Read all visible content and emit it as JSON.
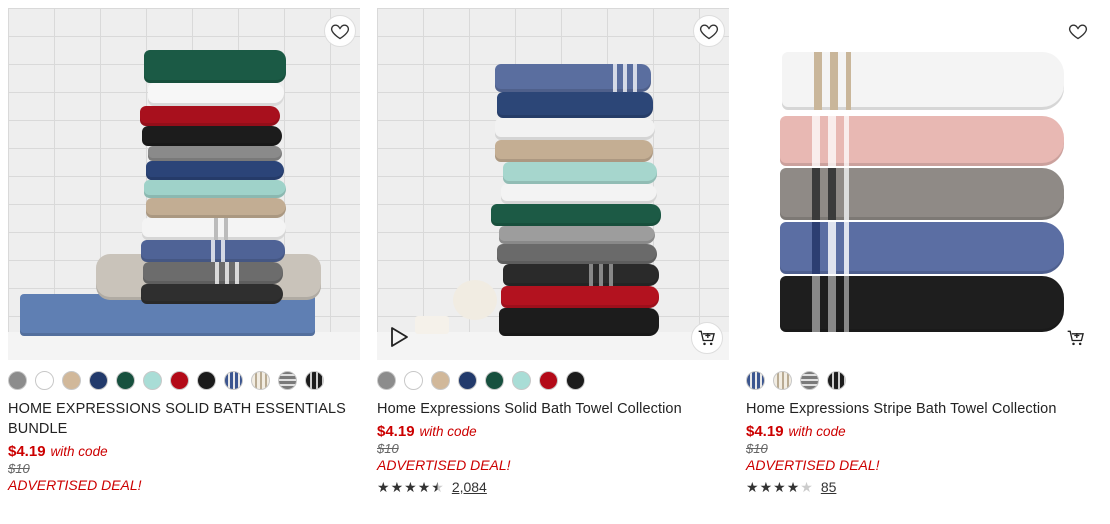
{
  "products": [
    {
      "title": "HOME EXPRESSIONS SOLID BATH ESSENTIALS BUNDLE",
      "price": "$4.19",
      "price_note": "with code",
      "original_price": "$10",
      "deal": "ADVERTISED DEAL!",
      "swatch_colors": [
        "#8c8c8c",
        "#ffffff",
        "#d1b89a",
        "#223a6b",
        "#17503e",
        "#a9ddd6",
        "#b30a18",
        "#1b1b1b",
        "stripe-navy",
        "stripe-cream",
        "stripe-grey",
        "stripe-black"
      ],
      "icons": {
        "favorite": "heart-icon"
      }
    },
    {
      "title": "Home Expressions Solid Bath Towel Collection",
      "price": "$4.19",
      "price_note": "with code",
      "original_price": "$10",
      "deal": "ADVERTISED DEAL!",
      "rating": 4.5,
      "review_count": "2,084",
      "swatch_colors": [
        "#8c8c8c",
        "#ffffff",
        "#d1b89a",
        "#223a6b",
        "#17503e",
        "#a9ddd6",
        "#b30a18",
        "#1b1b1b"
      ],
      "icons": {
        "favorite": "heart-icon",
        "video": "play-icon",
        "cart": "add-to-cart-icon"
      }
    },
    {
      "title": "Home Expressions Stripe Bath Towel Collection",
      "price": "$4.19",
      "price_note": "with code",
      "original_price": "$10",
      "deal": "ADVERTISED DEAL!",
      "rating": 4,
      "review_count": "85",
      "swatch_colors": [
        "stripe-navy",
        "stripe-cream",
        "stripe-grey",
        "stripe-black"
      ],
      "icons": {
        "favorite": "heart-icon",
        "cart": "add-to-cart-icon"
      }
    }
  ],
  "colors": {
    "sale_red": "#cc0000",
    "text": "#222222"
  }
}
